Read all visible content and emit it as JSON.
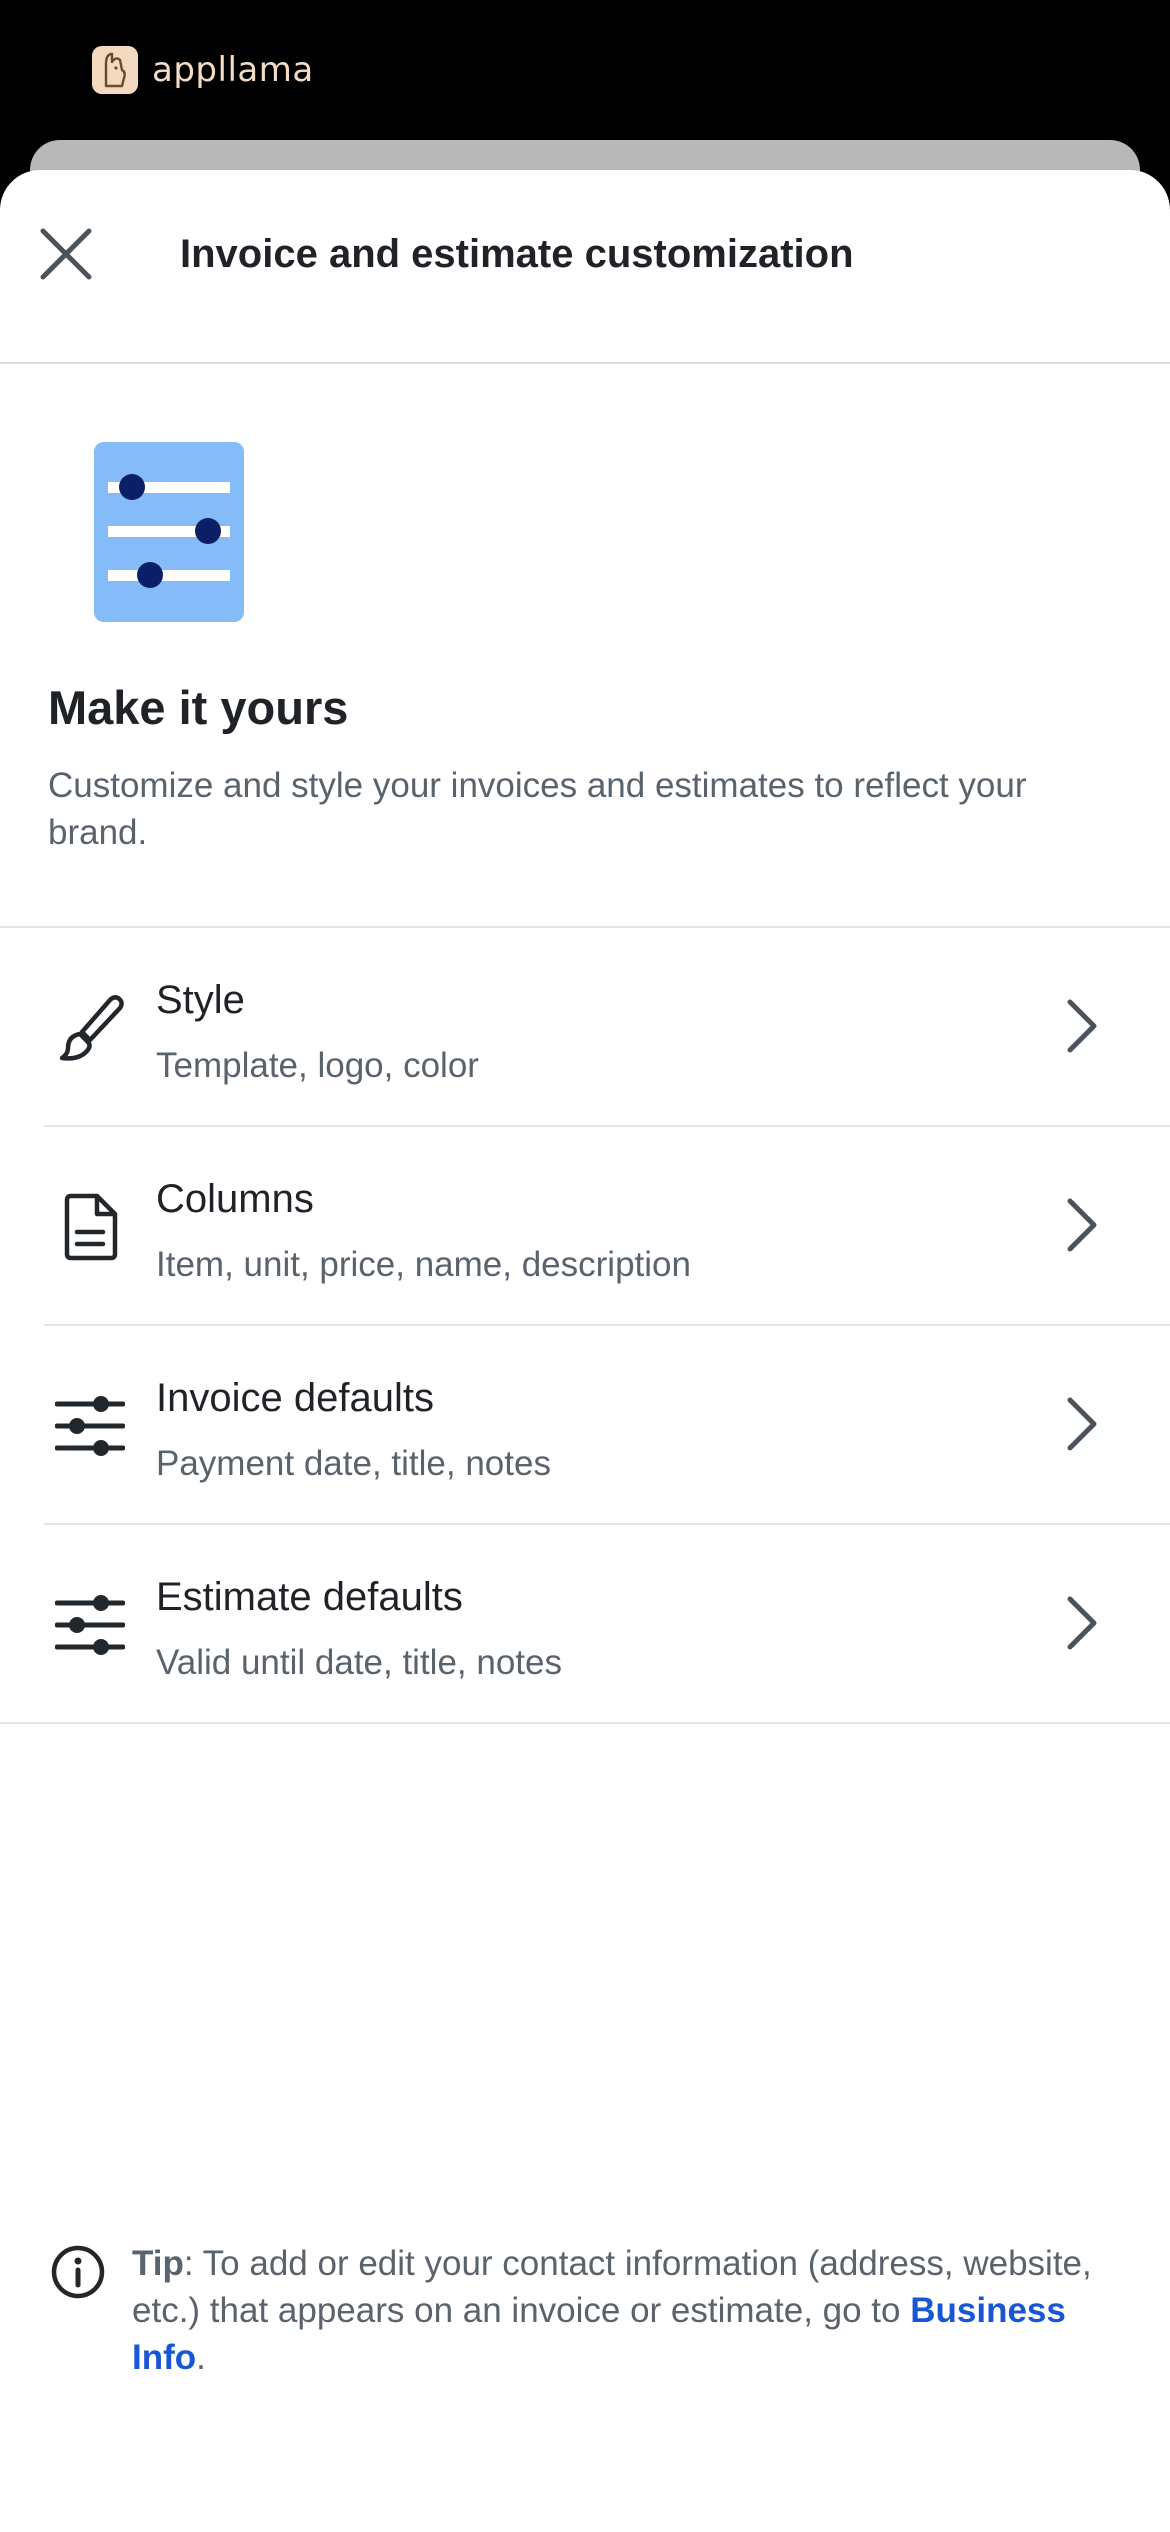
{
  "app": {
    "brand_name": "appllama"
  },
  "sheet": {
    "title": "Invoice and estimate customization",
    "close_icon": "close-icon"
  },
  "hero": {
    "illustration": "sliders-card-icon",
    "title": "Make it yours",
    "description": "Customize and style your invoices and estimates to reflect your brand."
  },
  "options": [
    {
      "icon": "brush-icon",
      "title": "Style",
      "subtitle": "Template, logo, color"
    },
    {
      "icon": "document-icon",
      "title": "Columns",
      "subtitle": "Item, unit, price, name, description"
    },
    {
      "icon": "sliders-icon",
      "title": "Invoice defaults",
      "subtitle": "Payment date, title, notes"
    },
    {
      "icon": "sliders-icon",
      "title": "Estimate defaults",
      "subtitle": "Valid until date, title, notes"
    }
  ],
  "tip": {
    "label": "Tip",
    "text_before": ": To add or edit your contact information (address, website, etc.) that appears on an invoice or estimate, go to ",
    "link": "Business Info",
    "text_after": "."
  },
  "colors": {
    "link": "#1856d3",
    "illustration_card": "#86bbfa",
    "illustration_dot": "#0a1f66"
  }
}
